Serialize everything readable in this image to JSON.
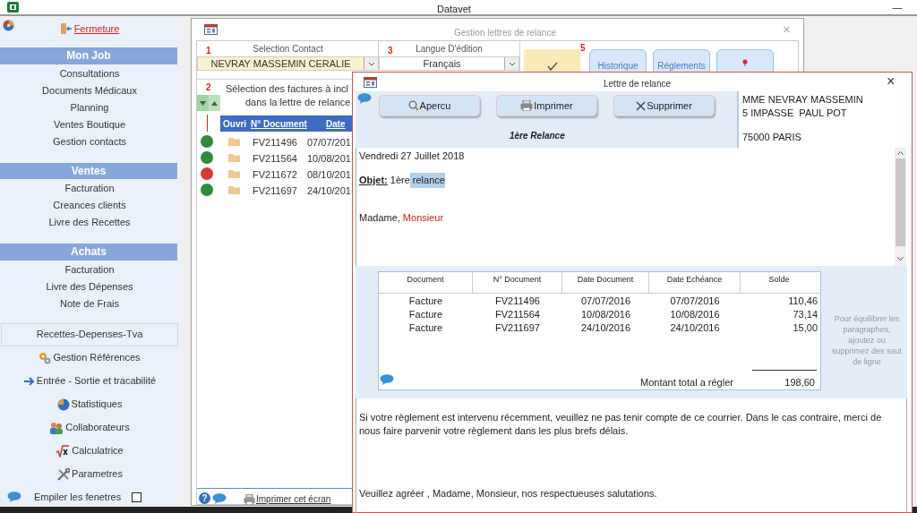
{
  "app": {
    "title": "Datavet",
    "minimize": "—"
  },
  "sidebar": {
    "close_link": "Fermeture",
    "sections": [
      {
        "title": "Mon Job",
        "items": [
          "Consultations",
          "Documents Médicaux",
          "Planning",
          "Ventes Boutique",
          "Gestion contacts"
        ]
      },
      {
        "title": "Ventes",
        "items": [
          "Facturation",
          "Creances clients",
          "Livre des Recettes"
        ]
      },
      {
        "title": "Achats",
        "items": [
          "Facturation",
          "Livre des Dépenses",
          "Note de Frais"
        ]
      }
    ],
    "tools": [
      {
        "kind": "boxed",
        "label": "Recettes-Depenses-Tva"
      },
      {
        "kind": "icon",
        "label": "Gestion Références"
      },
      {
        "kind": "icon",
        "label": "Entrée - Sortie et tracabilité"
      },
      {
        "kind": "icon",
        "label": "Statistiques"
      },
      {
        "kind": "icon",
        "label": "Collaborateurs"
      },
      {
        "kind": "icon",
        "label": "Calculatrice"
      },
      {
        "kind": "icon",
        "label": "Parametres"
      }
    ],
    "stack_windows": {
      "label": "Empiler les fenetres",
      "checked": false
    }
  },
  "main_window": {
    "title": "Gestion  lettres de relance",
    "close": "×",
    "contact": {
      "step": "1",
      "label": "Selection Contact",
      "value": "NEVRAY MASSEMIN CERALIE"
    },
    "language": {
      "step": "3",
      "label": "Langue D'édition",
      "value": "Français"
    },
    "actions_step": "5",
    "buttons": [
      "Historique",
      "Réglements"
    ],
    "invoices": {
      "step": "2",
      "title_lines": [
        "Sélection des factures à incl",
        "dans la lettre de relance"
      ],
      "columns": [
        "Ouvri",
        "N° Document",
        "Date"
      ],
      "rows": [
        {
          "color": "#2f8a3a",
          "number": "FV211496",
          "date": "07/07/201"
        },
        {
          "color": "#2f8a3a",
          "number": "FV211564",
          "date": "10/08/201"
        },
        {
          "color": "#d83a32",
          "number": "FV211672",
          "date": "08/10/201"
        },
        {
          "color": "#2f8a3a",
          "number": "FV211697",
          "date": "24/10/201"
        }
      ]
    },
    "help": "?",
    "footer_link": "Imprimer cet écran"
  },
  "letter_window": {
    "title": "Lettre de relance",
    "close": "×",
    "buttons": [
      "Apercu",
      "Imprimer",
      "Supprimer"
    ],
    "reminder": "1ère Relance",
    "address": [
      "MME NEVRAY MASSEMIN",
      "5 IMPASSE  PAUL POT"
    ],
    "city": "75000 PARIS",
    "date": "Vendredi 27 Juillet 2018",
    "subject_label": "Objet:",
    "subject": "1ère",
    "subject_selected": "relance",
    "greeting": "Madame,",
    "greeting_highlight": "Monsieur",
    "table": {
      "columns": [
        "Document",
        "N° Document",
        "Date Document",
        "Date Echéance",
        "Solde"
      ],
      "rows": [
        [
          "Facture",
          "FV211496",
          "07/07/2016",
          "07/07/2016",
          "110,46"
        ],
        [
          "Facture",
          "FV211564",
          "10/08/2016",
          "10/08/2016",
          "73,14"
        ],
        [
          "Facture",
          "FV211697",
          "24/10/2016",
          "24/10/2016",
          "15,00"
        ]
      ],
      "total_label": "Montant total a régler",
      "total": "198,60"
    },
    "side_note": "Pour équilibrer les paragraphes, ajoutez ou supprimez des saut de ligne",
    "paragraph": "Si votre règlement est intervenu récemment, veuillez ne pas tenir compte de ce courrier. Dans le cas contraire, merci de nous faire parvenir votre règlement dans les plus brefs délais.",
    "closing": "Veuillez agréer , Madame, Monsieur, nos respectueuses salutations."
  }
}
